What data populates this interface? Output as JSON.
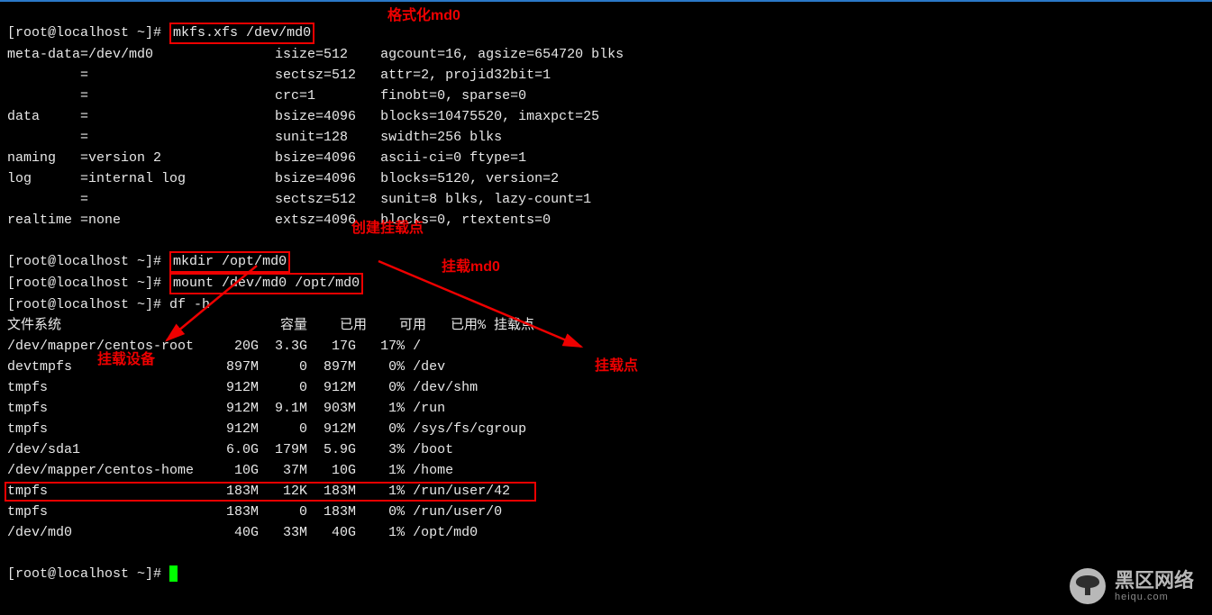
{
  "prompt": "[root@localhost ~]#",
  "commands": {
    "mkfs": "mkfs.xfs /dev/md0",
    "mkdir": "mkdir /opt/md0",
    "mount": "mount /dev/md0 /opt/md0",
    "df": "df -h"
  },
  "annotations": {
    "format": "格式化md0",
    "create_mountpoint": "创建挂载点",
    "mount_md0": "挂载md0",
    "mount_device": "挂载设备",
    "mount_point": "挂载点"
  },
  "mkfs_output": [
    "meta-data=/dev/md0               isize=512    agcount=16, agsize=654720 blks",
    "         =                       sectsz=512   attr=2, projid32bit=1",
    "         =                       crc=1        finobt=0, sparse=0",
    "data     =                       bsize=4096   blocks=10475520, imaxpct=25",
    "         =                       sunit=128    swidth=256 blks",
    "naming   =version 2              bsize=4096   ascii-ci=0 ftype=1",
    "log      =internal log           bsize=4096   blocks=5120, version=2",
    "         =                       sectsz=512   sunit=8 blks, lazy-count=1",
    "realtime =none                   extsz=4096   blocks=0, rtextents=0"
  ],
  "df_header": {
    "fs": "文件系统",
    "size": "容量",
    "used": "已用",
    "avail": "可用",
    "pct": "已用%",
    "mount": "挂载点"
  },
  "df_rows": [
    {
      "fs": "/dev/mapper/centos-root",
      "size": "20G",
      "used": "3.3G",
      "avail": "17G",
      "pct": "17%",
      "mount": "/"
    },
    {
      "fs": "devtmpfs",
      "size": "897M",
      "used": "0",
      "avail": "897M",
      "pct": "0%",
      "mount": "/dev"
    },
    {
      "fs": "tmpfs",
      "size": "912M",
      "used": "0",
      "avail": "912M",
      "pct": "0%",
      "mount": "/dev/shm"
    },
    {
      "fs": "tmpfs",
      "size": "912M",
      "used": "9.1M",
      "avail": "903M",
      "pct": "1%",
      "mount": "/run"
    },
    {
      "fs": "tmpfs",
      "size": "912M",
      "used": "0",
      "avail": "912M",
      "pct": "0%",
      "mount": "/sys/fs/cgroup"
    },
    {
      "fs": "/dev/sda1",
      "size": "6.0G",
      "used": "179M",
      "avail": "5.9G",
      "pct": "3%",
      "mount": "/boot"
    },
    {
      "fs": "/dev/mapper/centos-home",
      "size": "10G",
      "used": "37M",
      "avail": "10G",
      "pct": "1%",
      "mount": "/home"
    },
    {
      "fs": "tmpfs",
      "size": "183M",
      "used": "12K",
      "avail": "183M",
      "pct": "1%",
      "mount": "/run/user/42"
    },
    {
      "fs": "tmpfs",
      "size": "183M",
      "used": "0",
      "avail": "183M",
      "pct": "0%",
      "mount": "/run/user/0"
    },
    {
      "fs": "/dev/md0",
      "size": "40G",
      "used": "33M",
      "avail": "40G",
      "pct": "1%",
      "mount": "/opt/md0"
    }
  ],
  "watermark": {
    "title": "黑区网络",
    "sub": "heiqu.com"
  }
}
